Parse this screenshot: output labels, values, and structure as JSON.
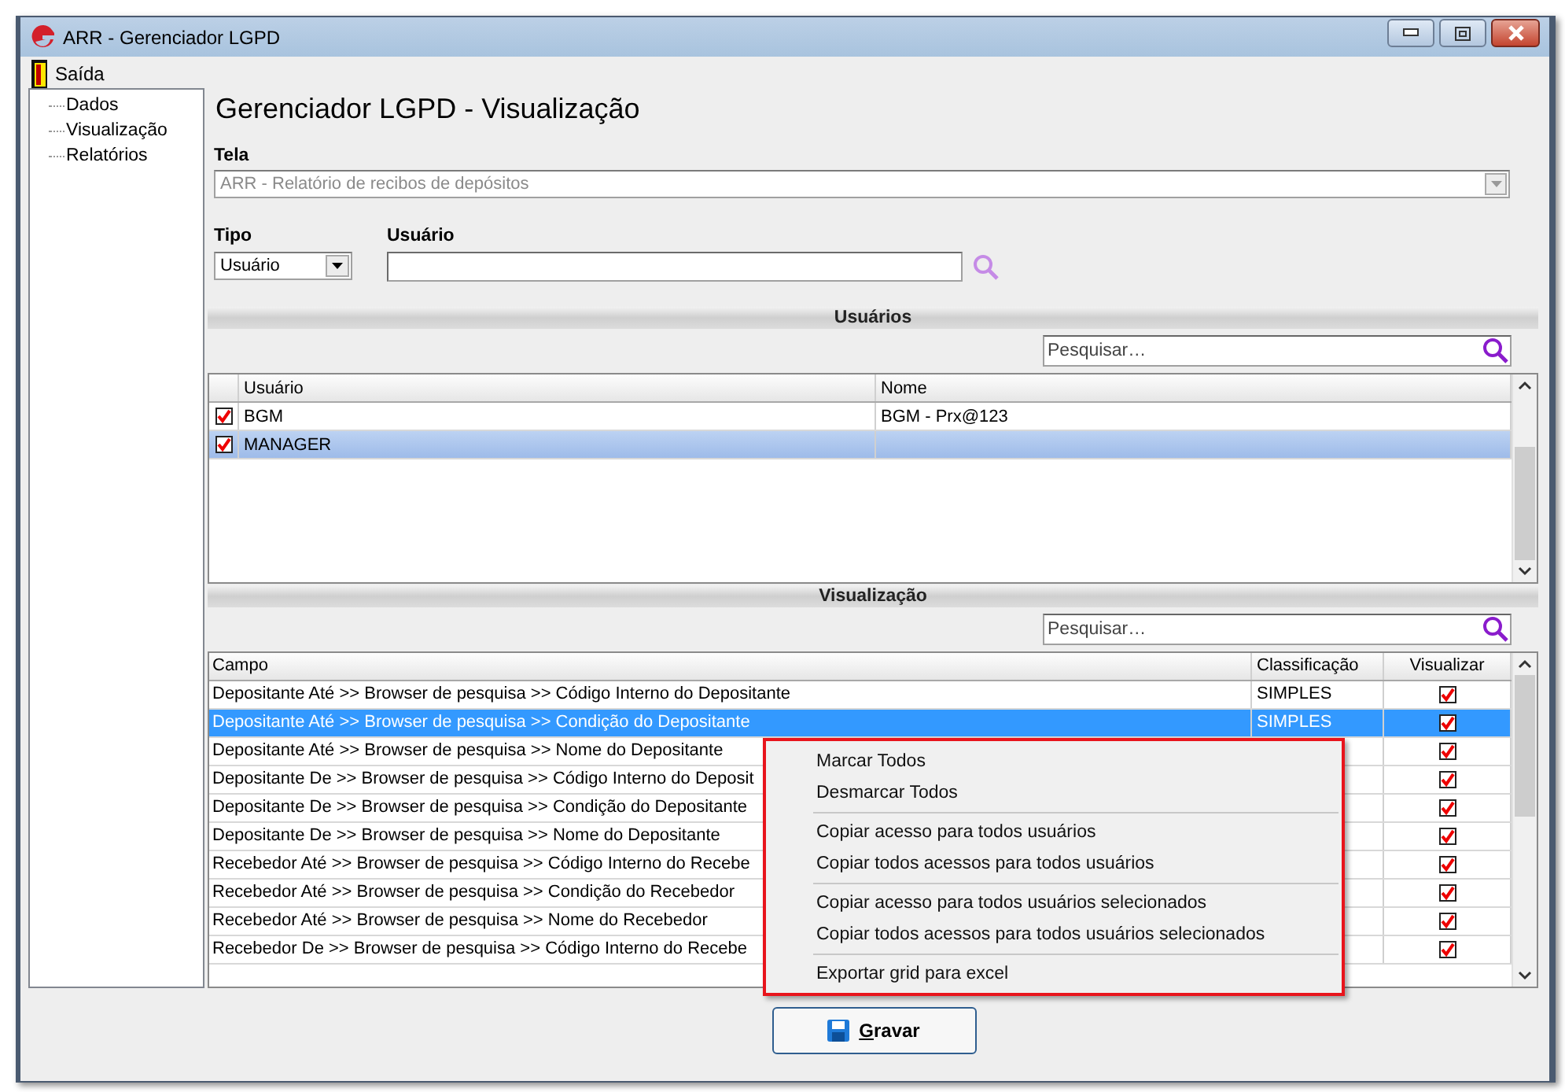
{
  "window": {
    "title": "ARR - Gerenciador LGPD"
  },
  "menu_bar": [
    {
      "label": "Saída"
    }
  ],
  "sidebar": {
    "items": [
      {
        "label": "Dados"
      },
      {
        "label": "Visualização"
      },
      {
        "label": "Relatórios"
      }
    ]
  },
  "page_title": "Gerenciador LGPD - Visualização",
  "tela": {
    "label": "Tela",
    "value": "ARR - Relatório de recibos de depósitos",
    "disabled": true
  },
  "tipo": {
    "label": "Tipo",
    "value": "Usuário"
  },
  "usuario": {
    "label": "Usuário"
  },
  "users_section": {
    "title": "Usuários",
    "search": {
      "placeholder": "Pesquisar…"
    },
    "columns": [
      "Usuário",
      "Nome"
    ],
    "rows": [
      {
        "usuario": "BGM",
        "nome": "BGM - Prx@123",
        "checked": true,
        "selected": false
      },
      {
        "usuario": "MANAGER",
        "checked": true,
        "selected": true
      }
    ]
  },
  "fields_section": {
    "title": "Visualização",
    "search": {
      "placeholder": "Pesquisar…"
    },
    "columns": [
      "Campo",
      "Classificação",
      "Visualizar"
    ],
    "rows": [
      {
        "campo": "Depositante Até >> Browser de pesquisa >> Código Interno do Depositante",
        "classificacao": "SIMPLES",
        "visualizar": true,
        "selected": false
      },
      {
        "campo": "Depositante Até >> Browser de pesquisa >> Condição do Depositante",
        "classificacao": "SIMPLES",
        "visualizar": true,
        "selected": true
      },
      {
        "campo": "Depositante Até >> Browser de pesquisa >> Nome do Depositante",
        "visualizar": true,
        "selected": false
      },
      {
        "campo": "Depositante De >> Browser de pesquisa >> Código Interno do Deposit",
        "visualizar": true,
        "selected": false
      },
      {
        "campo": "Depositante De >> Browser de pesquisa >> Condição do Depositante",
        "visualizar": true,
        "selected": false
      },
      {
        "campo": "Depositante De >> Browser de pesquisa >> Nome do Depositante",
        "visualizar": true,
        "selected": false
      },
      {
        "campo": "Recebedor Até >> Browser de pesquisa >> Código Interno do Recebe",
        "visualizar": true,
        "selected": false
      },
      {
        "campo": "Recebedor Até >> Browser de pesquisa >> Condição do Recebedor",
        "visualizar": true,
        "selected": false
      },
      {
        "campo": "Recebedor Até >> Browser de pesquisa >> Nome do Recebedor",
        "visualizar": true,
        "selected": false
      },
      {
        "campo": "Recebedor De >> Browser de pesquisa >> Código Interno do Recebe",
        "visualizar": true,
        "selected": false
      }
    ]
  },
  "context_menu": {
    "items": [
      {
        "kind": "item",
        "label": "Marcar Todos"
      },
      {
        "kind": "item",
        "label": "Desmarcar Todos"
      },
      {
        "kind": "separator"
      },
      {
        "kind": "item",
        "label": "Copiar acesso para todos usuários"
      },
      {
        "kind": "item",
        "label": "Copiar todos acessos para todos usuários"
      },
      {
        "kind": "separator"
      },
      {
        "kind": "item",
        "label": "Copiar acesso para todos usuários selecionados"
      },
      {
        "kind": "item",
        "label": "Copiar todos acessos para todos usuários selecionados"
      },
      {
        "kind": "separator"
      },
      {
        "kind": "item",
        "label": "Exportar grid para excel"
      }
    ]
  },
  "buttons": [
    {
      "label": "Gravar"
    }
  ]
}
